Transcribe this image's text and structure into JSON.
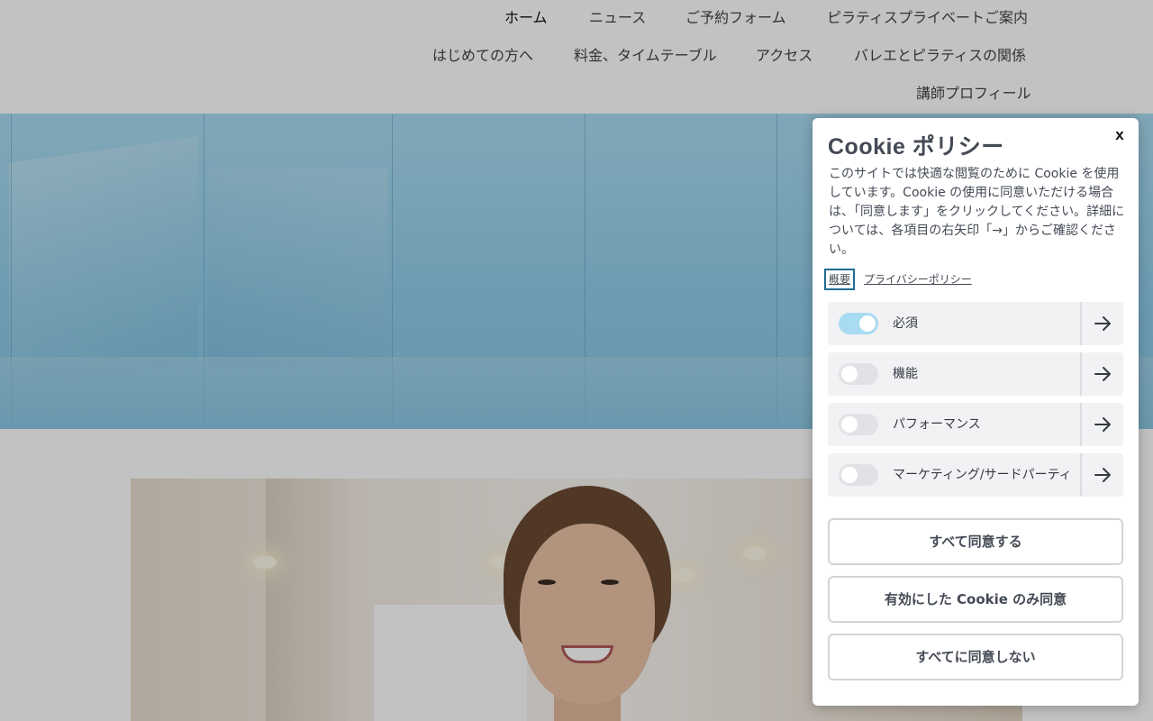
{
  "nav": {
    "items": [
      "ホーム",
      "ニュース",
      "ご予約フォーム",
      "ピラティスプライベートご案内",
      "はじめての方へ",
      "料金、タイムテーブル",
      "アクセス",
      "バレエとピラティスの関係",
      "講師プロフィール"
    ],
    "active": "ホーム"
  },
  "cookie": {
    "title": "Cookie ポリシー",
    "close_label": "x",
    "description": "このサイトでは快適な閲覧のために Cookie を使用しています。Cookie の使用に同意いただける場合は、「同意します」をクリックしてください。詳細については、各項目の右矢印「→」からご確認ください。",
    "links": {
      "overview": "概要",
      "privacy": "プライバシーポリシー"
    },
    "categories": [
      {
        "label": "必須",
        "enabled": true
      },
      {
        "label": "機能",
        "enabled": false
      },
      {
        "label": "パフォーマンス",
        "enabled": false
      },
      {
        "label": "マーケティング/サードパーティ",
        "enabled": false
      }
    ],
    "buttons": {
      "accept_all": "すべて同意する",
      "accept_selected": "有効にした Cookie のみ同意",
      "reject_all": "すべてに同意しない"
    }
  },
  "colors": {
    "toggle_on": "#a9dbf2",
    "toggle_off": "#e2e2e6",
    "focus_outline": "#1e6c93",
    "overlay": "rgba(0,0,0,0.24)"
  },
  "icons": {
    "category_arrow": "arrow-right-icon",
    "close": "close-icon"
  }
}
